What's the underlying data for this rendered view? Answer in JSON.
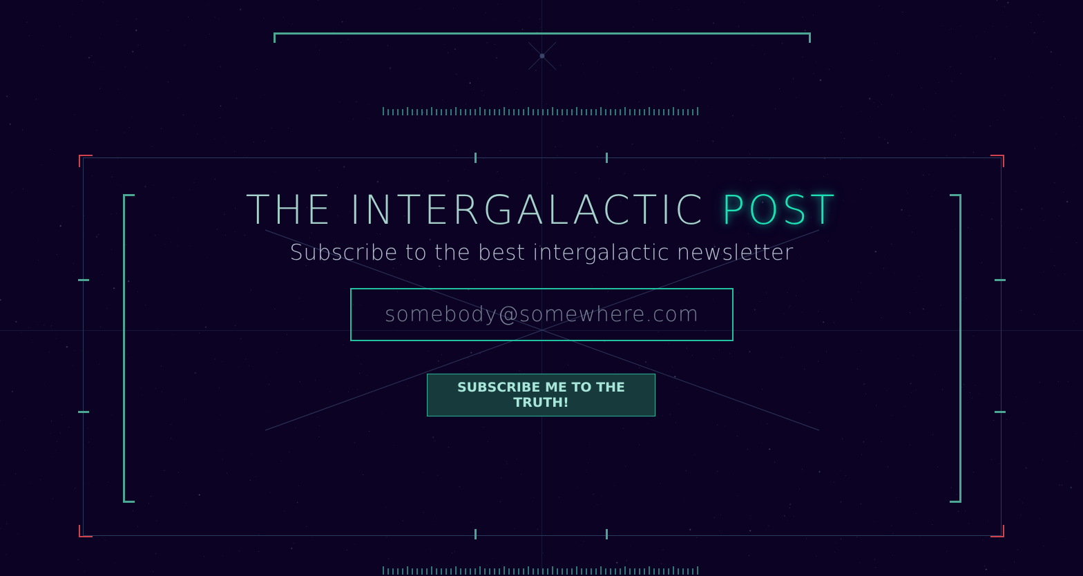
{
  "header": {
    "title_main": "THE INTERGALACTIC",
    "title_accent": "POST",
    "subtitle": "Subscribe to the best intergalactic newsletter"
  },
  "form": {
    "email_placeholder": "somebody@somewhere.com",
    "submit_label": "SUBSCRIBE ME TO THE TRUTH!"
  },
  "colors": {
    "background": "#0b0224",
    "accent": "#1de0b5",
    "hud_line": "#4aa794",
    "corner_red": "#d1424c",
    "title_text": "#a7d2cb",
    "subtitle_text": "#b7c0cf",
    "button_bg": "#173b3d"
  },
  "icons": {
    "crosshair": "crosshair-icon",
    "corner_markers": "corner-bracket-icon"
  }
}
